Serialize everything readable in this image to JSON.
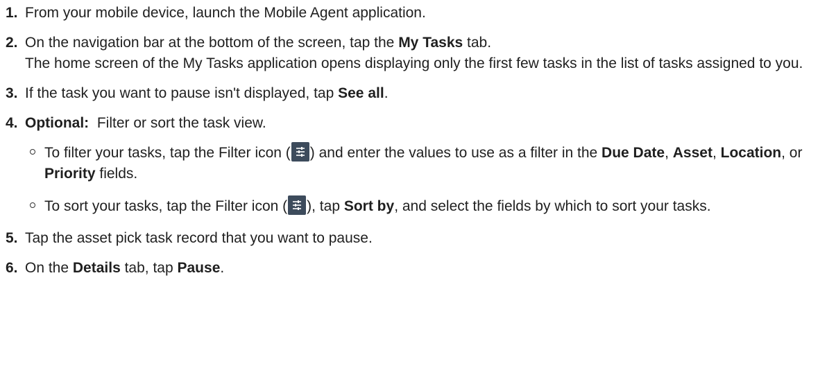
{
  "steps": [
    {
      "num": "1.",
      "text": "From your mobile device, launch the Mobile Agent application."
    },
    {
      "num": "2.",
      "pre": "On the navigation bar at the bottom of the screen, tap the ",
      "bold": "My Tasks",
      "post": " tab.",
      "result": "The home screen of the My Tasks application opens displaying only the first few tasks in the list of tasks assigned to you."
    },
    {
      "num": "3.",
      "pre": "If the task you want to pause isn't displayed, tap ",
      "bold": "See all",
      "post": "."
    },
    {
      "num": "4.",
      "label": "Optional:",
      "text": "Filter or sort the task view.",
      "subitems": [
        {
          "a": "To filter your tasks, tap the Filter icon (",
          "icon": "filter-icon",
          "b": ") and enter the values to use as a filter in the ",
          "f1": "Due Date",
          "c": ", ",
          "f2": "Asset",
          "d": ", ",
          "f3": "Location",
          "e": ", or ",
          "f4": "Priority",
          "f": " fields."
        },
        {
          "a": "To sort your tasks, tap the Filter icon (",
          "icon": "filter-icon",
          "b": "), tap ",
          "f1": "Sort by",
          "c": ", and select the fields by which to sort your tasks."
        }
      ]
    },
    {
      "num": "5.",
      "text": "Tap the asset pick task record that you want to pause."
    },
    {
      "num": "6.",
      "pre": "On the ",
      "bold": "Details",
      "mid": " tab, tap ",
      "bold2": "Pause",
      "post": "."
    }
  ],
  "colors": {
    "text": "#1f1f1f",
    "icon_bg": "#3d4b5c"
  }
}
